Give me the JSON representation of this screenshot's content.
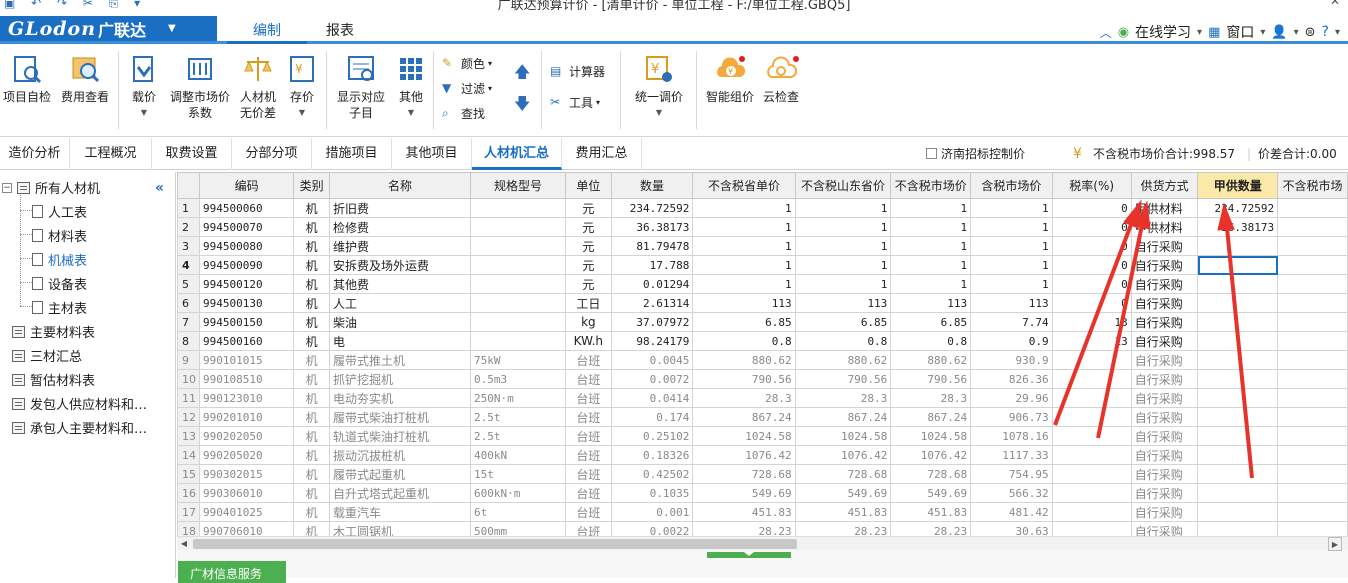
{
  "titlebar": {
    "title": "广联达预算计价 - [清单计价 - 单位工程 - F:/单位工程.GBQ5]"
  },
  "logo": {
    "brand": "GLodon",
    "name": "广联达"
  },
  "menu": {
    "tabs": [
      "编制",
      "报表"
    ],
    "active": 0
  },
  "menu_right": {
    "online_learning": "在线学习",
    "window": "窗口",
    "help": "?"
  },
  "ribbon": {
    "buttons": [
      {
        "label": "项目自检"
      },
      {
        "label": "费用查看"
      },
      {
        "label": "载价"
      },
      {
        "label": "调整市场价\n系数"
      },
      {
        "label": "人材机\n无价差"
      },
      {
        "label": "存价"
      },
      {
        "label": "显示对应\n子目"
      },
      {
        "label": "其他"
      },
      {
        "label": "统一调价"
      },
      {
        "label": "智能组价"
      },
      {
        "label": "云检查"
      }
    ],
    "small": {
      "color": "颜色",
      "filter": "过滤",
      "find": "查找",
      "calculator": "计算器",
      "tools": "工具"
    }
  },
  "subtabs": [
    "造价分析",
    "工程概况",
    "取费设置",
    "分部分项",
    "措施项目",
    "其他项目",
    "人材机汇总",
    "费用汇总"
  ],
  "subtab_active": 6,
  "summary": {
    "checkbox_label": "济南招标控制价",
    "total_label": "不含税市场价合计:998.57",
    "diff_label": "价差合计:0.00"
  },
  "tree": {
    "root": "所有人材机",
    "children": [
      "人工表",
      "材料表",
      "机械表",
      "设备表",
      "主材表"
    ],
    "selected": 2,
    "others": [
      "主要材料表",
      "三材汇总",
      "暂估材料表",
      "发包人供应材料和…",
      "承包人主要材料和…"
    ]
  },
  "info_button": "广材信息服务",
  "grid": {
    "columns": [
      "",
      "编码",
      "类别",
      "名称",
      "规格型号",
      "单位",
      "数量",
      "不含税省单价",
      "不含税山东省价",
      "不含税市场价",
      "含税市场价",
      "税率(%)",
      "供货方式",
      "甲供数量",
      "不含税市场"
    ],
    "highlight_col": 13,
    "current_row": 4,
    "rows": [
      {
        "no": "1",
        "code": "994500060",
        "cat": "机",
        "name": "折旧费",
        "spec": "",
        "unit": "元",
        "qty": "234.72592",
        "p1": "1",
        "p2": "1",
        "p3": "1",
        "p4": "1",
        "tax": "0",
        "supply": "甲供材料",
        "jqty": "234.72592",
        "gray": false
      },
      {
        "no": "2",
        "code": "994500070",
        "cat": "机",
        "name": "检修费",
        "spec": "",
        "unit": "元",
        "qty": "36.38173",
        "p1": "1",
        "p2": "1",
        "p3": "1",
        "p4": "1",
        "tax": "0",
        "supply": "甲供材料",
        "jqty": "36.38173",
        "gray": false
      },
      {
        "no": "3",
        "code": "994500080",
        "cat": "机",
        "name": "维护费",
        "spec": "",
        "unit": "元",
        "qty": "81.79478",
        "p1": "1",
        "p2": "1",
        "p3": "1",
        "p4": "1",
        "tax": "0",
        "supply": "自行采购",
        "jqty": "",
        "gray": false
      },
      {
        "no": "4",
        "code": "994500090",
        "cat": "机",
        "name": "安拆费及场外运费",
        "spec": "",
        "unit": "元",
        "qty": "17.788",
        "p1": "1",
        "p2": "1",
        "p3": "1",
        "p4": "1",
        "tax": "0",
        "supply": "自行采购",
        "jqty": "",
        "gray": false
      },
      {
        "no": "5",
        "code": "994500120",
        "cat": "机",
        "name": "其他费",
        "spec": "",
        "unit": "元",
        "qty": "0.01294",
        "p1": "1",
        "p2": "1",
        "p3": "1",
        "p4": "1",
        "tax": "0",
        "supply": "自行采购",
        "jqty": "",
        "gray": false
      },
      {
        "no": "6",
        "code": "994500130",
        "cat": "机",
        "name": "人工",
        "spec": "",
        "unit": "工日",
        "qty": "2.61314",
        "p1": "113",
        "p2": "113",
        "p3": "113",
        "p4": "113",
        "tax": "0",
        "supply": "自行采购",
        "jqty": "",
        "gray": false
      },
      {
        "no": "7",
        "code": "994500150",
        "cat": "机",
        "name": "柴油",
        "spec": "",
        "unit": "kg",
        "qty": "37.07972",
        "p1": "6.85",
        "p2": "6.85",
        "p3": "6.85",
        "p4": "7.74",
        "tax": "13",
        "supply": "自行采购",
        "jqty": "",
        "gray": false
      },
      {
        "no": "8",
        "code": "994500160",
        "cat": "机",
        "name": "电",
        "spec": "",
        "unit": "KW.h",
        "qty": "98.24179",
        "p1": "0.8",
        "p2": "0.8",
        "p3": "0.8",
        "p4": "0.9",
        "tax": "13",
        "supply": "自行采购",
        "jqty": "",
        "gray": false
      },
      {
        "no": "9",
        "code": "990101015",
        "cat": "机",
        "name": "履带式推土机",
        "spec": "75kW",
        "unit": "台班",
        "qty": "0.0045",
        "p1": "880.62",
        "p2": "880.62",
        "p3": "880.62",
        "p4": "930.9",
        "tax": "",
        "supply": "自行采购",
        "jqty": "",
        "gray": true
      },
      {
        "no": "10",
        "code": "990108510",
        "cat": "机",
        "name": "抓铲挖掘机",
        "spec": "0.5m3",
        "unit": "台班",
        "qty": "0.0072",
        "p1": "790.56",
        "p2": "790.56",
        "p3": "790.56",
        "p4": "826.36",
        "tax": "",
        "supply": "自行采购",
        "jqty": "",
        "gray": true
      },
      {
        "no": "11",
        "code": "990123010",
        "cat": "机",
        "name": "电动夯实机",
        "spec": "250N·m",
        "unit": "台班",
        "qty": "0.0414",
        "p1": "28.3",
        "p2": "28.3",
        "p3": "28.3",
        "p4": "29.96",
        "tax": "",
        "supply": "自行采购",
        "jqty": "",
        "gray": true
      },
      {
        "no": "12",
        "code": "990201010",
        "cat": "机",
        "name": "履带式柴油打桩机",
        "spec": "2.5t",
        "unit": "台班",
        "qty": "0.174",
        "p1": "867.24",
        "p2": "867.24",
        "p3": "867.24",
        "p4": "906.73",
        "tax": "",
        "supply": "自行采购",
        "jqty": "",
        "gray": true
      },
      {
        "no": "13",
        "code": "990202050",
        "cat": "机",
        "name": "轨道式柴油打桩机",
        "spec": "2.5t",
        "unit": "台班",
        "qty": "0.25102",
        "p1": "1024.58",
        "p2": "1024.58",
        "p3": "1024.58",
        "p4": "1078.16",
        "tax": "",
        "supply": "自行采购",
        "jqty": "",
        "gray": true
      },
      {
        "no": "14",
        "code": "990205020",
        "cat": "机",
        "name": "振动沉拔桩机",
        "spec": "400kN",
        "unit": "台班",
        "qty": "0.18326",
        "p1": "1076.42",
        "p2": "1076.42",
        "p3": "1076.42",
        "p4": "1117.33",
        "tax": "",
        "supply": "自行采购",
        "jqty": "",
        "gray": true
      },
      {
        "no": "15",
        "code": "990302015",
        "cat": "机",
        "name": "履带式起重机",
        "spec": "15t",
        "unit": "台班",
        "qty": "0.42502",
        "p1": "728.68",
        "p2": "728.68",
        "p3": "728.68",
        "p4": "754.95",
        "tax": "",
        "supply": "自行采购",
        "jqty": "",
        "gray": true
      },
      {
        "no": "16",
        "code": "990306010",
        "cat": "机",
        "name": "自升式塔式起重机",
        "spec": "600kN·m",
        "unit": "台班",
        "qty": "0.1035",
        "p1": "549.69",
        "p2": "549.69",
        "p3": "549.69",
        "p4": "566.32",
        "tax": "",
        "supply": "自行采购",
        "jqty": "",
        "gray": true
      },
      {
        "no": "17",
        "code": "990401025",
        "cat": "机",
        "name": "载重汽车",
        "spec": "6t",
        "unit": "台班",
        "qty": "0.001",
        "p1": "451.83",
        "p2": "451.83",
        "p3": "451.83",
        "p4": "481.42",
        "tax": "",
        "supply": "自行采购",
        "jqty": "",
        "gray": true
      },
      {
        "no": "18",
        "code": "990706010",
        "cat": "机",
        "name": "木工圆锯机",
        "spec": "500mm",
        "unit": "台班",
        "qty": "0.0022",
        "p1": "28.23",
        "p2": "28.23",
        "p3": "28.23",
        "p4": "30.63",
        "tax": "",
        "supply": "自行采购",
        "jqty": "",
        "gray": true
      }
    ]
  },
  "colors": {
    "accent": "#1b6fc2",
    "header_highlight": "#fbe9a8",
    "annotation": "#e8332a",
    "info_green": "#4caf50"
  }
}
